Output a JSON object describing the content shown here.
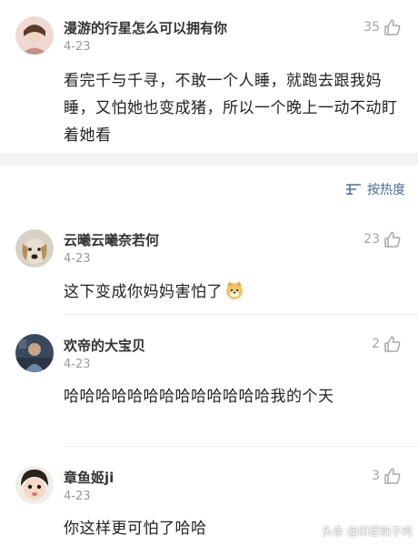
{
  "comments_top": [
    {
      "username": "漫游的行星怎么可以拥有你",
      "date": "4-23",
      "likes": "35",
      "content": "看完千与千寻，不敢一个人睡，就跑去跟我妈睡，又怕她也变成猪，所以一个晚上一动不动盯着她看"
    }
  ],
  "sort": {
    "label": "按热度"
  },
  "comments": [
    {
      "username": "云曦云曦奈若何",
      "date": "4-23",
      "likes": "23",
      "content": "这下变成你妈妈害怕了"
    },
    {
      "username": "欢帝的大宝贝",
      "date": "4-23",
      "likes": "2",
      "content": "哈哈哈哈哈哈哈哈哈哈哈哈哈我的个天"
    },
    {
      "username": "章鱼姬ji",
      "date": "4-23",
      "likes": "3",
      "content": "你这样更可怕了哈哈"
    }
  ],
  "watermark": "头条 @印尼辣子鸡",
  "colors": {
    "link_blue": "#4a6f95",
    "meta_gray": "#9a9a9a",
    "divider": "#ececec"
  }
}
